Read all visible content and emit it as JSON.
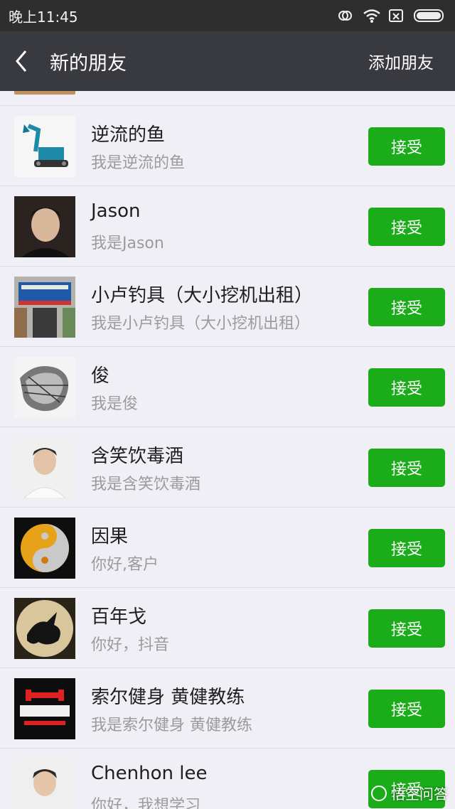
{
  "status_bar": {
    "time": "晚上11:45"
  },
  "nav": {
    "title": "新的朋友",
    "action": "添加朋友"
  },
  "requests": [
    {
      "name": "逆流的鱼",
      "message": "我是逆流的鱼",
      "button": "接受",
      "avatar": "excavator"
    },
    {
      "name": "Jason",
      "message": "我是Jason",
      "button": "接受",
      "avatar": "person-dark"
    },
    {
      "name": "小卢钓具（大小挖机出租）",
      "message": "我是小卢钓具（大小挖机出租）",
      "button": "接受",
      "avatar": "storefront"
    },
    {
      "name": "俊",
      "message": "我是俊",
      "button": "接受",
      "avatar": "abstract-sketch"
    },
    {
      "name": "含笑饮毒酒",
      "message": "我是含笑饮毒酒",
      "button": "接受",
      "avatar": "person-white-shirt"
    },
    {
      "name": "因果",
      "message": "你好,客户",
      "button": "接受",
      "avatar": "yin-yang"
    },
    {
      "name": "百年戈",
      "message": "你好，抖音",
      "button": "接受",
      "avatar": "dragon"
    },
    {
      "name": "索尔健身  黄健教练",
      "message": "我是索尔健身  黄健教练",
      "button": "接受",
      "avatar": "gym-logo"
    },
    {
      "name": "Chenhon lee",
      "message": "你好，我想学习",
      "button": "接受",
      "avatar": "child"
    }
  ],
  "watermark": {
    "text": "悟空问答"
  },
  "colors": {
    "accept_green": "#1aad19",
    "navbar": "#393a3f",
    "background": "#f0eff5"
  }
}
